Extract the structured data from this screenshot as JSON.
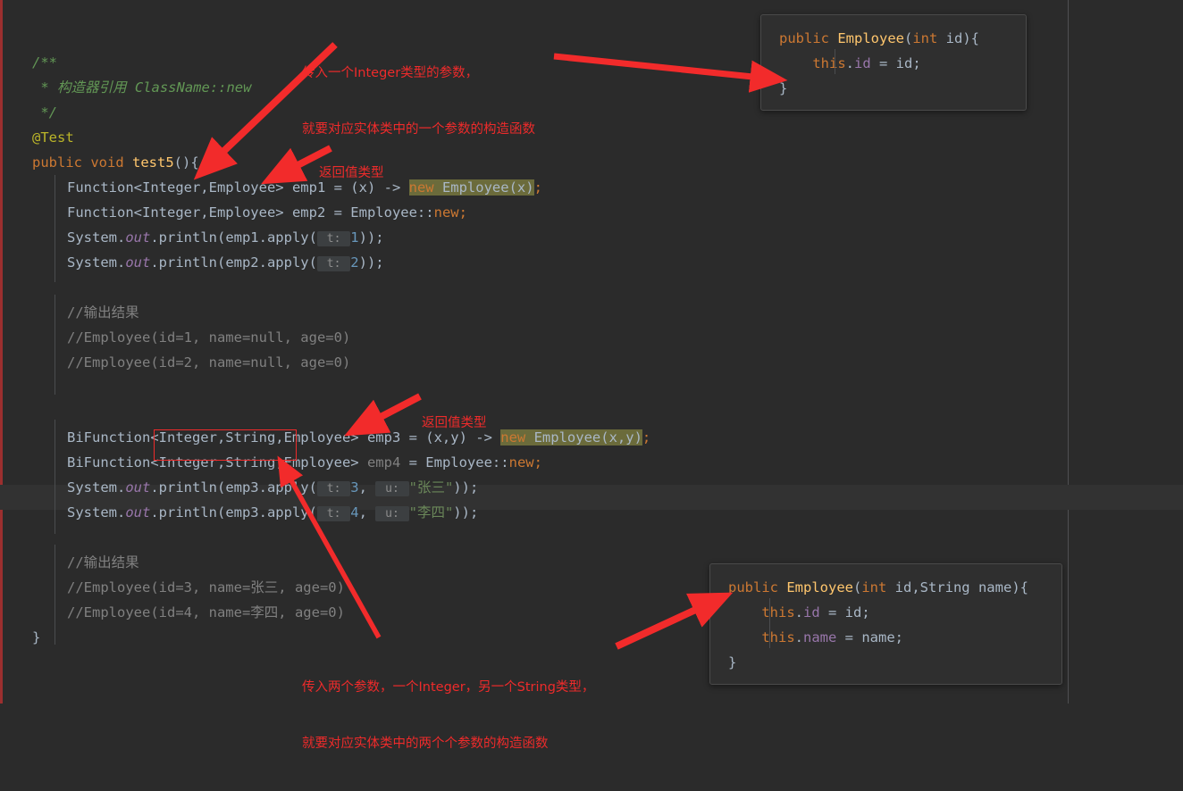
{
  "editor": {
    "background": "#2b2b2b",
    "accent_red": "#ee2b2b",
    "highlight_bg": "#6b6b3b",
    "current_line_bg": "#323232"
  },
  "code": {
    "lines": [
      {
        "indent": 0,
        "segments": [
          {
            "t": "/**",
            "c": "t-cmt"
          }
        ]
      },
      {
        "indent": 0,
        "segments": [
          {
            "t": " * 构造器引用 ClassName::new",
            "c": "t-cmt"
          }
        ]
      },
      {
        "indent": 0,
        "segments": [
          {
            "t": " */",
            "c": "t-cmt"
          }
        ]
      },
      {
        "indent": 0,
        "segments": [
          {
            "t": "@Test",
            "c": "t-ann"
          }
        ]
      },
      {
        "indent": 0,
        "segments": [
          {
            "t": "public ",
            "c": "t-kw"
          },
          {
            "t": "void ",
            "c": "t-kw"
          },
          {
            "t": "test5",
            "c": "t-fn"
          },
          {
            "t": "(){",
            "c": "t-pl"
          }
        ]
      },
      {
        "indent": 1,
        "segments": [
          {
            "t": "Function<Integer,Employee> emp1 = (x) -> ",
            "c": "t-pl"
          },
          {
            "t": "new ",
            "c": "t-kw",
            "hl": true
          },
          {
            "t": "Employee(x)",
            "c": "t-pl",
            "hl": true
          },
          {
            "t": ";",
            "c": "t-orange"
          }
        ]
      },
      {
        "indent": 1,
        "segments": [
          {
            "t": "Function<Integer,Employee> emp2 = Employee::",
            "c": "t-pl"
          },
          {
            "t": "new",
            "c": "t-kw"
          },
          {
            "t": ";",
            "c": "t-orange"
          }
        ]
      },
      {
        "indent": 1,
        "segments": [
          {
            "t": "System.",
            "c": "t-pl"
          },
          {
            "t": "out",
            "c": "t-fld"
          },
          {
            "t": ".println(emp1.apply(",
            "c": "t-pl"
          },
          {
            "t": " t: ",
            "c": "hint"
          },
          {
            "t": "1",
            "c": "t-num"
          },
          {
            "t": "));",
            "c": "t-pl"
          }
        ]
      },
      {
        "indent": 1,
        "segments": [
          {
            "t": "System.",
            "c": "t-pl"
          },
          {
            "t": "out",
            "c": "t-fld"
          },
          {
            "t": ".println(emp2.apply(",
            "c": "t-pl"
          },
          {
            "t": " t: ",
            "c": "hint"
          },
          {
            "t": "2",
            "c": "t-num"
          },
          {
            "t": "));",
            "c": "t-pl"
          }
        ]
      },
      {
        "indent": 0,
        "segments": []
      },
      {
        "indent": 1,
        "segments": [
          {
            "t": "//输出结果",
            "c": "t-cmt2"
          }
        ]
      },
      {
        "indent": 1,
        "segments": [
          {
            "t": "//Employee(id=1, name=null, age=0)",
            "c": "t-cmt2"
          }
        ]
      },
      {
        "indent": 1,
        "segments": [
          {
            "t": "//Employee(id=2, name=null, age=0)",
            "c": "t-cmt2"
          }
        ]
      },
      {
        "indent": 0,
        "segments": []
      },
      {
        "indent": 0,
        "segments": []
      },
      {
        "indent": 1,
        "segments": [
          {
            "t": "BiFunction<Integer,String,Employee> emp3 = (x,y) -> ",
            "c": "t-pl"
          },
          {
            "t": "new ",
            "c": "t-kw",
            "hl": true
          },
          {
            "t": "Employee(x,y)",
            "c": "t-pl",
            "hl": true
          },
          {
            "t": ";",
            "c": "t-orange"
          }
        ]
      },
      {
        "indent": 1,
        "segments": [
          {
            "t": "BiFunction<Integer,String,Employee> ",
            "c": "t-pl"
          },
          {
            "t": "emp4",
            "c": "t-gray"
          },
          {
            "t": " = Employee::",
            "c": "t-pl"
          },
          {
            "t": "new",
            "c": "t-kw"
          },
          {
            "t": ";",
            "c": "t-orange"
          }
        ]
      },
      {
        "indent": 1,
        "cur": true,
        "segments": [
          {
            "t": "System.",
            "c": "t-pl"
          },
          {
            "t": "out",
            "c": "t-fld"
          },
          {
            "t": ".println(emp3.apply(",
            "c": "t-pl"
          },
          {
            "t": " t: ",
            "c": "hint"
          },
          {
            "t": "3",
            "c": "t-num"
          },
          {
            "t": ", ",
            "c": "t-pl"
          },
          {
            "t": " u: ",
            "c": "hint"
          },
          {
            "t": "\"张三\"",
            "c": "t-str"
          },
          {
            "t": "));",
            "c": "t-pl"
          }
        ]
      },
      {
        "indent": 1,
        "segments": [
          {
            "t": "System.",
            "c": "t-pl"
          },
          {
            "t": "out",
            "c": "t-fld"
          },
          {
            "t": ".println(emp3.apply(",
            "c": "t-pl"
          },
          {
            "t": " t: ",
            "c": "hint"
          },
          {
            "t": "4",
            "c": "t-num"
          },
          {
            "t": ", ",
            "c": "t-pl"
          },
          {
            "t": " u: ",
            "c": "hint"
          },
          {
            "t": "\"李四\"",
            "c": "t-str"
          },
          {
            "t": "));",
            "c": "t-pl"
          }
        ]
      },
      {
        "indent": 0,
        "segments": []
      },
      {
        "indent": 1,
        "segments": [
          {
            "t": "//输出结果",
            "c": "t-cmt2"
          }
        ]
      },
      {
        "indent": 1,
        "segments": [
          {
            "t": "//Employee(id=3, name=张三, age=0)",
            "c": "t-cmt2"
          }
        ]
      },
      {
        "indent": 1,
        "segments": [
          {
            "t": "//Employee(id=4, name=李四, age=0)",
            "c": "t-cmt2"
          }
        ]
      },
      {
        "indent": 0,
        "segments": [
          {
            "t": "}",
            "c": "t-pl"
          }
        ]
      }
    ]
  },
  "snippets": [
    {
      "id": "constructor-one-arg",
      "lines": [
        {
          "segments": [
            {
              "t": "public ",
              "c": "t-kw"
            },
            {
              "t": "Employee",
              "c": "t-fn"
            },
            {
              "t": "(",
              "c": "t-pl"
            },
            {
              "t": "int ",
              "c": "t-kw"
            },
            {
              "t": "id",
              "c": "t-pl"
            },
            {
              "t": "){",
              "c": "t-pl"
            }
          ]
        },
        {
          "segments": [
            {
              "t": "    ",
              "c": "t-pl"
            },
            {
              "t": "this",
              "c": "t-kw"
            },
            {
              "t": ".",
              "c": "t-pl"
            },
            {
              "t": "id",
              "c": "t-fld2"
            },
            {
              "t": " = id;",
              "c": "t-pl"
            }
          ]
        },
        {
          "segments": [
            {
              "t": "}",
              "c": "t-pl"
            }
          ]
        }
      ]
    },
    {
      "id": "constructor-two-args",
      "lines": [
        {
          "segments": [
            {
              "t": "public ",
              "c": "t-kw"
            },
            {
              "t": "Employee",
              "c": "t-fn"
            },
            {
              "t": "(",
              "c": "t-pl"
            },
            {
              "t": "int ",
              "c": "t-kw"
            },
            {
              "t": "id,String name",
              "c": "t-pl"
            },
            {
              "t": "){",
              "c": "t-pl"
            }
          ]
        },
        {
          "segments": [
            {
              "t": "    ",
              "c": "t-pl"
            },
            {
              "t": "this",
              "c": "t-kw"
            },
            {
              "t": ".",
              "c": "t-pl"
            },
            {
              "t": "id",
              "c": "t-fld2"
            },
            {
              "t": " = id;",
              "c": "t-pl"
            }
          ]
        },
        {
          "segments": [
            {
              "t": "    ",
              "c": "t-pl"
            },
            {
              "t": "this",
              "c": "t-kw"
            },
            {
              "t": ".",
              "c": "t-pl"
            },
            {
              "t": "name",
              "c": "t-fld2"
            },
            {
              "t": " = name;",
              "c": "t-pl"
            }
          ]
        },
        {
          "segments": [
            {
              "t": "}",
              "c": "t-pl"
            }
          ]
        }
      ]
    }
  ],
  "annotations": [
    {
      "id": "one-integer-param-note",
      "line1": "传入一个Integer类型的参数，",
      "line2": "就要对应实体类中的一个参数的构造函数"
    },
    {
      "id": "return-type-note-1",
      "line1": "返回值类型",
      "line2": ""
    },
    {
      "id": "return-type-note-2",
      "line1": "返回值类型",
      "line2": ""
    },
    {
      "id": "two-params-note",
      "line1": "传入两个参数，一个Integer，另一个String类型，",
      "line2": "就要对应实体类中的两个个参数的构造函数"
    }
  ]
}
